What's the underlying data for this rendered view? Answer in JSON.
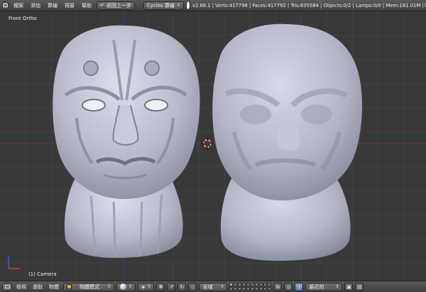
{
  "header": {
    "menus": [
      "檔案",
      "添加",
      "算繪",
      "視窗",
      "幫助"
    ],
    "undo_label": "返回上一步",
    "render_engine": "Cycles 算繪",
    "stats": "v2.66.1 | Verts:417796 | Faces:417792 | Tris:835584 | Objects:0/2 | Lamps:0/0 | Mem:181.01M (72.5"
  },
  "viewport": {
    "view_name": "Front Ortho",
    "active_object": "(1) Camera"
  },
  "footer": {
    "menus": [
      "檢視",
      "選取",
      "物體"
    ],
    "mode": "物體模式",
    "pivot": "全域",
    "snap_target": "最近的"
  },
  "colors": {
    "background": "#393939",
    "mesh": "#c4c6d6",
    "x_axis": "#8a2f2f",
    "y_axis": "#2f3f9a",
    "header": "#4a4a4a"
  },
  "icons": {
    "editor_type": "3d-view-icon",
    "blender": "blender-logo-icon",
    "cursor": "3d-cursor-icon",
    "gizmo": "axis-gizmo-icon"
  }
}
